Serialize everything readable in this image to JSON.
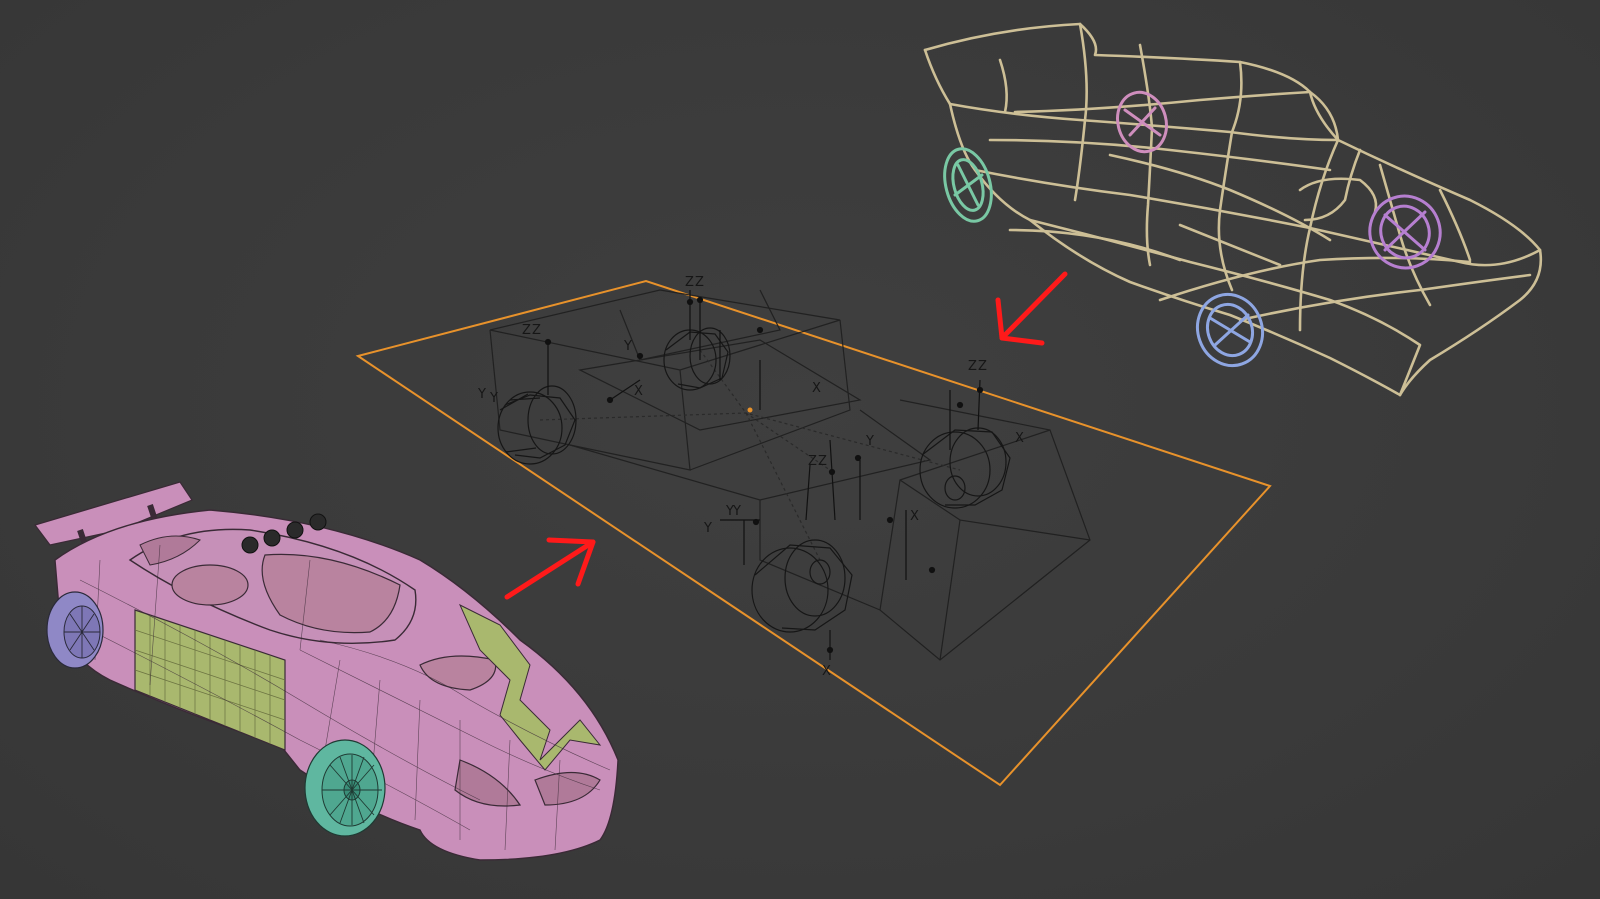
{
  "viewport": {
    "background": "#3a3a3a",
    "objects": {
      "car_mesh": {
        "body_color": "#c98fba",
        "panel_color": "#a9b86e",
        "front_wheel_color": "#5fb7a0",
        "rear_wheel_color": "#8f88c6"
      },
      "rig_proxy": {
        "selection_color": "#e8922b",
        "wire_color": "#1e1e1e"
      },
      "wire_car": {
        "wire_color": "#cdbf96",
        "wheel_colors": [
          "#79c8a4",
          "#cf8ebd",
          "#b67fd0",
          "#8ea6e2"
        ]
      },
      "arrows": {
        "color": "#ff1a1a"
      }
    },
    "axis_labels": {
      "z": "Z",
      "y": "Y",
      "x": "X"
    }
  }
}
